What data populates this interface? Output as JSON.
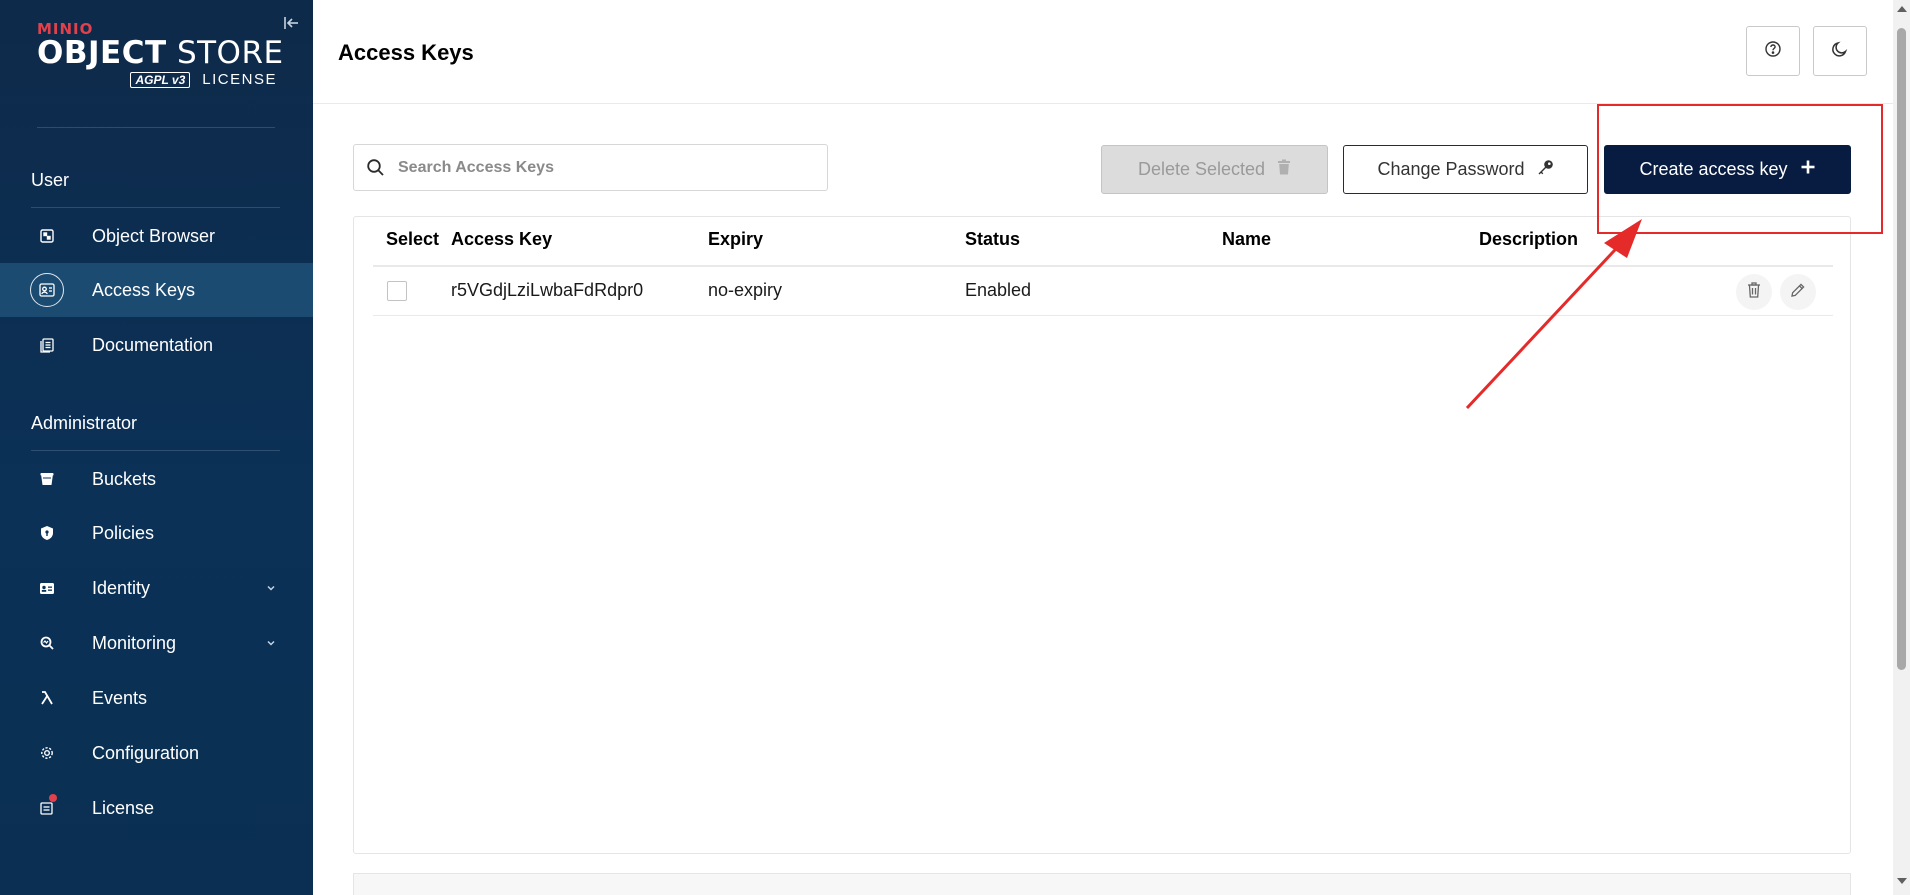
{
  "sidebar": {
    "logo": {
      "brand": "MINIO",
      "product_bold": "OBJECT",
      "product_light": " STORE",
      "badge": "AGPL v3",
      "license": "LICENSE"
    },
    "sections": [
      {
        "title": "User",
        "items": [
          {
            "label": "Object Browser",
            "icon": "object-browser-icon"
          },
          {
            "label": "Access Keys",
            "icon": "access-keys-icon",
            "active": true
          },
          {
            "label": "Documentation",
            "icon": "documentation-icon"
          }
        ]
      },
      {
        "title": "Administrator",
        "items": [
          {
            "label": "Buckets",
            "icon": "bucket-icon"
          },
          {
            "label": "Policies",
            "icon": "policy-icon"
          },
          {
            "label": "Identity",
            "icon": "identity-icon",
            "expandable": true
          },
          {
            "label": "Monitoring",
            "icon": "monitoring-icon",
            "expandable": true
          },
          {
            "label": "Events",
            "icon": "lambda-icon"
          },
          {
            "label": "Configuration",
            "icon": "gear-icon"
          },
          {
            "label": "License",
            "icon": "license-icon",
            "badge": true
          }
        ]
      }
    ]
  },
  "header": {
    "title": "Access Keys"
  },
  "toolbar": {
    "search_placeholder": "Search Access Keys",
    "search_value": "",
    "delete_label": "Delete Selected",
    "change_password_label": "Change Password",
    "create_label": "Create access key"
  },
  "table": {
    "columns": [
      "Select",
      "Access Key",
      "Expiry",
      "Status",
      "Name",
      "Description"
    ],
    "rows": [
      {
        "access_key": "r5VGdjLziLwbaFdRdpr0",
        "expiry": "no-expiry",
        "status": "Enabled",
        "name": "",
        "description": ""
      }
    ]
  },
  "colors": {
    "sidebar_bg": "#0b3157",
    "primary_button": "#081c42",
    "annotation": "#e52a2a",
    "license_dot": "#e2414b"
  }
}
